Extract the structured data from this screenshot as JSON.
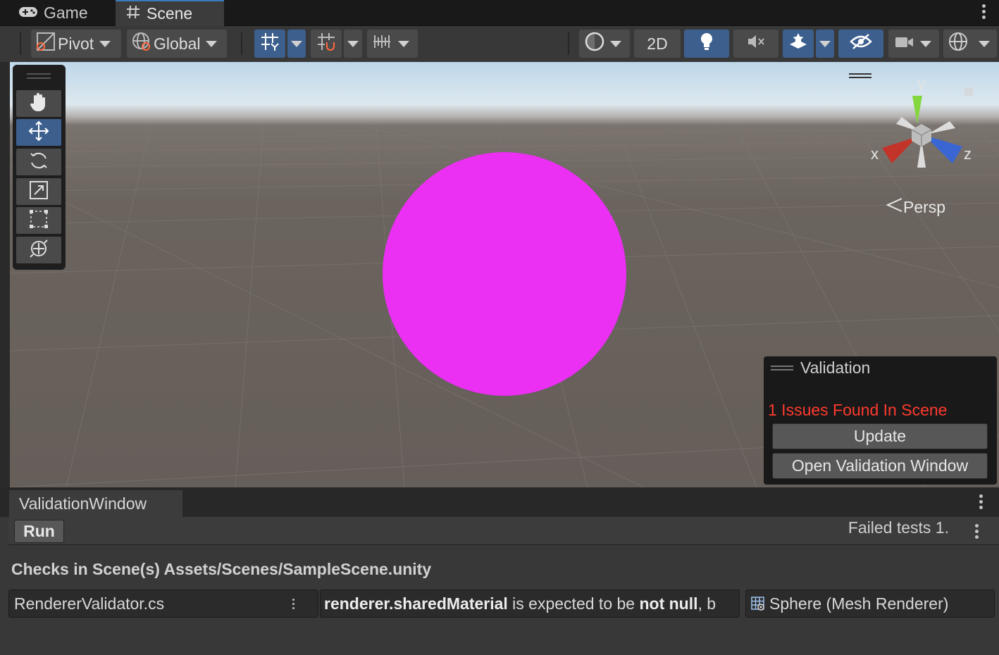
{
  "tabs": {
    "game_label": "Game",
    "scene_label": "Scene"
  },
  "toolbar": {
    "pivot_label": "Pivot",
    "global_label": "Global",
    "mode_2d_label": "2D"
  },
  "scene_view": {
    "persp_label": "Persp",
    "axis_x": "x",
    "axis_y": "y",
    "axis_z": "z",
    "sphere_color": "#eb2ff3"
  },
  "validation_overlay": {
    "title": "Validation",
    "issues_text": "1 Issues Found In Scene",
    "update_label": "Update",
    "open_window_label": "Open Validation Window"
  },
  "validation_window": {
    "tab_label": "ValidationWindow",
    "run_label": "Run",
    "failed_text": "Failed tests 1.",
    "checks_text": "Checks in Scene(s) Assets/Scenes/SampleScene.unity",
    "result": {
      "file": "RendererValidator.cs",
      "msg_part1": "renderer.sharedMaterial",
      "msg_part2": " is expected to be ",
      "msg_part3": "not null",
      "msg_part4": ", b",
      "object": "Sphere (Mesh Renderer)"
    }
  },
  "colors": {
    "accent": "#3c5f8e",
    "tab_highlight": "#3a79bb",
    "issue_red": "#ff3a2e"
  }
}
